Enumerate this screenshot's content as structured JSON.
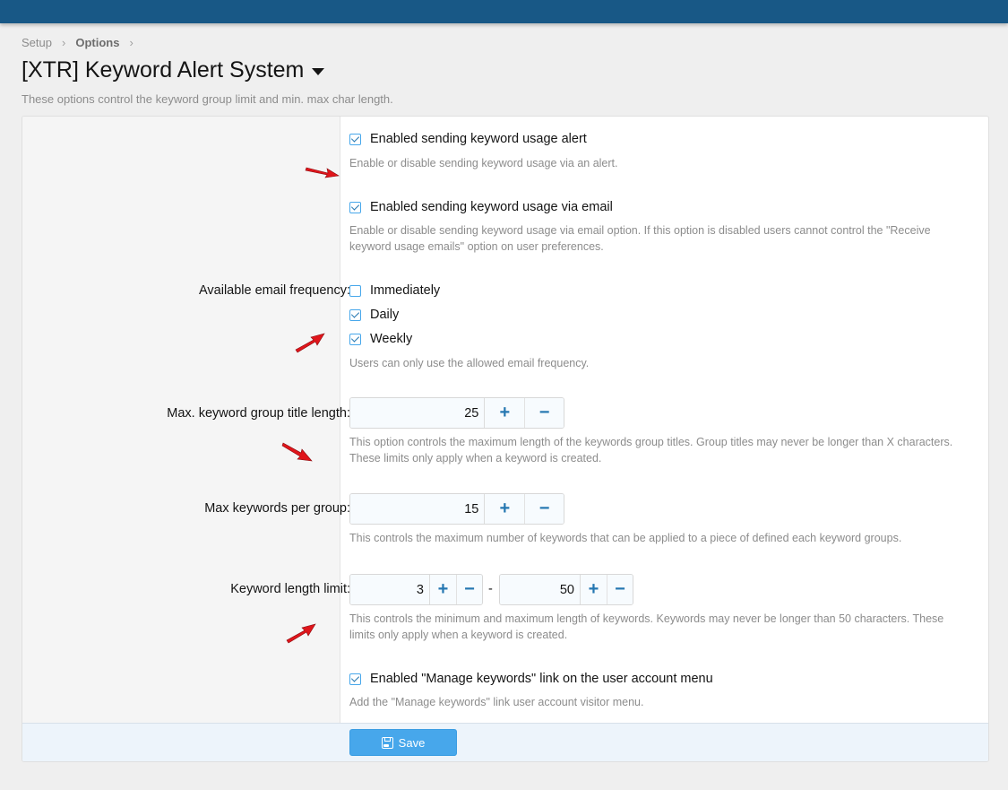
{
  "breadcrumb": {
    "setup": "Setup",
    "options": "Options"
  },
  "page": {
    "title": "[XTR] Keyword Alert System",
    "description": "These options control the keyword group limit and min. max char length."
  },
  "options": {
    "alert": {
      "label": "Enabled sending keyword usage alert",
      "checked": true,
      "hint": "Enable or disable sending keyword usage via an alert."
    },
    "email": {
      "label": "Enabled sending keyword usage via email",
      "checked": true,
      "hint1": "Enable or disable sending keyword usage via email option. If this option is disabled users cannot control the \"Receive",
      "hint2": "keyword usage emails\" option on user preferences."
    },
    "frequency": {
      "row_label": "Available email frequency:",
      "items": [
        {
          "label": "Immediately",
          "checked": false
        },
        {
          "label": "Daily",
          "checked": true
        },
        {
          "label": "Weekly",
          "checked": true
        }
      ],
      "hint": "Users can only use the allowed email frequency."
    },
    "title_length": {
      "row_label": "Max. keyword group title length:",
      "value": "25",
      "plus": "+",
      "minus": "−",
      "hint1": "This option controls the maximum length of the keywords group titles. Group titles may never be longer than X characters.",
      "hint2": "These limits only apply when a keyword is created."
    },
    "keywords_per_group": {
      "row_label": "Max keywords per group:",
      "value": "15",
      "plus": "+",
      "minus": "−",
      "hint": "This controls the maximum number of keywords that can be applied to a piece of defined each keyword groups."
    },
    "length_limit": {
      "row_label": "Keyword length limit:",
      "min": "3",
      "max": "50",
      "separator": "-",
      "plus": "+",
      "minus": "−",
      "hint1": "This controls the minimum and maximum length of keywords. Keywords may never be longer than 50 characters. These",
      "hint2": "limits only apply when a keyword is created."
    },
    "manage_link": {
      "label": "Enabled \"Manage keywords\" link on the user account menu",
      "checked": true,
      "hint": "Add the \"Manage keywords\" link user account visitor menu."
    }
  },
  "footer": {
    "save_label": "Save"
  },
  "colors": {
    "topbar": "#185886",
    "accent": "#47a7eb",
    "annotation_arrow": "#e0151b"
  }
}
